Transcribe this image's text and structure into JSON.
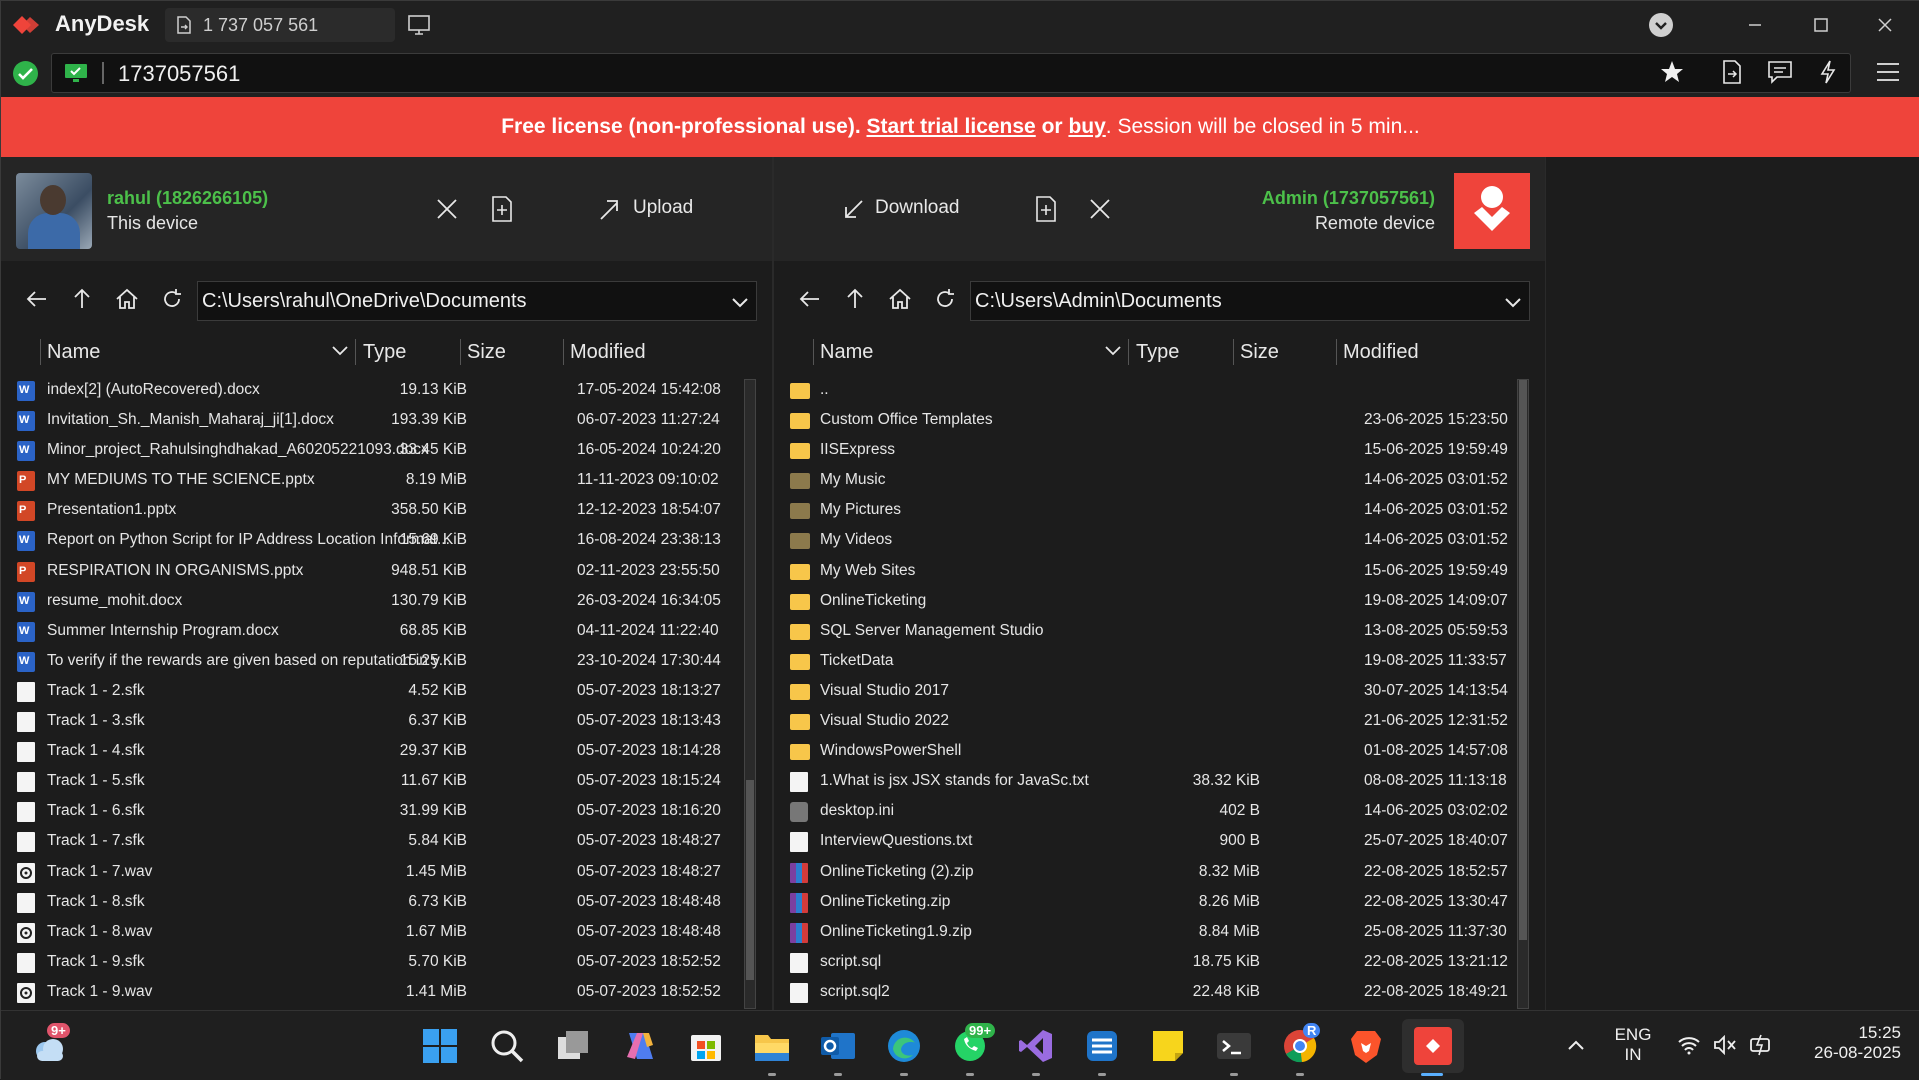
{
  "titlebar": {
    "app_name": "AnyDesk",
    "session_tab": "1 737 057 561"
  },
  "addressbar": {
    "value": "1737057561"
  },
  "banner": {
    "prefix": "Free license (non-professional use).",
    "trial_link": "Start trial license",
    "or": "or",
    "buy_link": "buy",
    "suffix": ". Session will be closed in 5 min..."
  },
  "local": {
    "user": "rahul (1826266105)",
    "subtitle": "This device",
    "upload_label": "Upload",
    "path": "C:\\Users\\rahul\\OneDrive\\Documents",
    "columns": {
      "name": "Name",
      "type": "Type",
      "size": "Size",
      "modified": "Modified"
    },
    "files": [
      {
        "icon": "word-icon",
        "name": "index[2] (AutoRecovered).docx",
        "size": "19.13 KiB",
        "modified": "17-05-2024 15:42:08"
      },
      {
        "icon": "word-icon",
        "name": "Invitation_Sh._Manish_Maharaj_ji[1].docx",
        "size": "193.39 KiB",
        "modified": "06-07-2023 11:27:24"
      },
      {
        "icon": "word-icon",
        "name": "Minor_project_Rahulsinghdhakad_A60205221093.docx",
        "size": "33.45 KiB",
        "modified": "16-05-2024 10:24:20"
      },
      {
        "icon": "ppt-icon",
        "name": "MY MEDIUMS TO THE SCIENCE.pptx",
        "size": "8.19 MiB",
        "modified": "11-11-2023 09:10:02"
      },
      {
        "icon": "ppt-icon",
        "name": "Presentation1.pptx",
        "size": "358.50 KiB",
        "modified": "12-12-2023 18:54:07"
      },
      {
        "icon": "word-icon",
        "name": "Report on Python Script for IP Address Location Informat...",
        "size": "15.69 KiB",
        "modified": "16-08-2024 23:38:13"
      },
      {
        "icon": "ppt-icon",
        "name": "RESPIRATION IN ORGANISMS.pptx",
        "size": "948.51 KiB",
        "modified": "02-11-2023 23:55:50"
      },
      {
        "icon": "word-icon",
        "name": "resume_mohit.docx",
        "size": "130.79 KiB",
        "modified": "26-03-2024 16:34:05"
      },
      {
        "icon": "word-icon",
        "name": "Summer Internship Program.docx",
        "size": "68.85 KiB",
        "modified": "04-11-2024 11:22:40"
      },
      {
        "icon": "word-icon",
        "name": "To verify if the rewards are given based on reputation in y...",
        "size": "15.25 KiB",
        "modified": "23-10-2024 17:30:44"
      },
      {
        "icon": "file-icon",
        "name": "Track 1 - 2.sfk",
        "size": "4.52 KiB",
        "modified": "05-07-2023 18:13:27"
      },
      {
        "icon": "file-icon",
        "name": "Track 1 - 3.sfk",
        "size": "6.37 KiB",
        "modified": "05-07-2023 18:13:43"
      },
      {
        "icon": "file-icon",
        "name": "Track 1 - 4.sfk",
        "size": "29.37 KiB",
        "modified": "05-07-2023 18:14:28"
      },
      {
        "icon": "file-icon",
        "name": "Track 1 - 5.sfk",
        "size": "11.67 KiB",
        "modified": "05-07-2023 18:15:24"
      },
      {
        "icon": "file-icon",
        "name": "Track 1 - 6.sfk",
        "size": "31.99 KiB",
        "modified": "05-07-2023 18:16:20"
      },
      {
        "icon": "file-icon",
        "name": "Track 1 - 7.sfk",
        "size": "5.84 KiB",
        "modified": "05-07-2023 18:48:27"
      },
      {
        "icon": "audio-icon",
        "name": "Track 1 - 7.wav",
        "size": "1.45 MiB",
        "modified": "05-07-2023 18:48:27"
      },
      {
        "icon": "file-icon",
        "name": "Track 1 - 8.sfk",
        "size": "6.73 KiB",
        "modified": "05-07-2023 18:48:48"
      },
      {
        "icon": "audio-icon",
        "name": "Track 1 - 8.wav",
        "size": "1.67 MiB",
        "modified": "05-07-2023 18:48:48"
      },
      {
        "icon": "file-icon",
        "name": "Track 1 - 9.sfk",
        "size": "5.70 KiB",
        "modified": "05-07-2023 18:52:52"
      },
      {
        "icon": "audio-icon",
        "name": "Track 1 - 9.wav",
        "size": "1.41 MiB",
        "modified": "05-07-2023 18:52:52"
      }
    ]
  },
  "remote": {
    "user": "Admin (1737057561)",
    "subtitle": "Remote device",
    "download_label": "Download",
    "path": "C:\\Users\\Admin\\Documents",
    "columns": {
      "name": "Name",
      "type": "Type",
      "size": "Size",
      "modified": "Modified"
    },
    "files": [
      {
        "icon": "folder-icon",
        "name": "..",
        "size": "",
        "modified": ""
      },
      {
        "icon": "folder-icon",
        "name": "Custom Office Templates",
        "size": "",
        "modified": "23-06-2025 15:23:50"
      },
      {
        "icon": "folder-icon",
        "name": "IISExpress",
        "size": "",
        "modified": "15-06-2025 19:59:49"
      },
      {
        "icon": "folder-dark-icon",
        "name": "My Music",
        "size": "",
        "modified": "14-06-2025 03:01:52"
      },
      {
        "icon": "folder-dark-icon",
        "name": "My Pictures",
        "size": "",
        "modified": "14-06-2025 03:01:52"
      },
      {
        "icon": "folder-dark-icon",
        "name": "My Videos",
        "size": "",
        "modified": "14-06-2025 03:01:52"
      },
      {
        "icon": "folder-icon",
        "name": "My Web Sites",
        "size": "",
        "modified": "15-06-2025 19:59:49"
      },
      {
        "icon": "folder-icon",
        "name": "OnlineTicketing",
        "size": "",
        "modified": "19-08-2025 14:09:07"
      },
      {
        "icon": "folder-icon",
        "name": "SQL Server Management Studio",
        "size": "",
        "modified": "13-08-2025 05:59:53"
      },
      {
        "icon": "folder-icon",
        "name": "TicketData",
        "size": "",
        "modified": "19-08-2025 11:33:57"
      },
      {
        "icon": "folder-icon",
        "name": "Visual Studio 2017",
        "size": "",
        "modified": "30-07-2025 14:13:54"
      },
      {
        "icon": "folder-icon",
        "name": "Visual Studio 2022",
        "size": "",
        "modified": "21-06-2025 12:31:52"
      },
      {
        "icon": "folder-icon",
        "name": "WindowsPowerShell",
        "size": "",
        "modified": "01-08-2025 14:57:08"
      },
      {
        "icon": "file-icon",
        "name": "1.What is jsx JSX stands for JavaSc.txt",
        "size": "38.32 KiB",
        "modified": "08-08-2025 11:13:18"
      },
      {
        "icon": "settings-file-icon",
        "name": "desktop.ini",
        "size": "402 B",
        "modified": "14-06-2025 03:02:02"
      },
      {
        "icon": "file-icon",
        "name": "InterviewQuestions.txt",
        "size": "900 B",
        "modified": "25-07-2025 18:40:07"
      },
      {
        "icon": "zip-icon",
        "name": "OnlineTicketing (2).zip",
        "size": "8.32 MiB",
        "modified": "22-08-2025 18:52:57"
      },
      {
        "icon": "zip-icon",
        "name": "OnlineTicketing.zip",
        "size": "8.26 MiB",
        "modified": "22-08-2025 13:30:47"
      },
      {
        "icon": "zip-icon",
        "name": "OnlineTicketing1.9.zip",
        "size": "8.84 MiB",
        "modified": "25-08-2025 11:37:30"
      },
      {
        "icon": "sql-icon",
        "name": "script.sql",
        "size": "18.75 KiB",
        "modified": "22-08-2025 13:21:12"
      },
      {
        "icon": "file-icon",
        "name": "script.sql2",
        "size": "22.48 KiB",
        "modified": "22-08-2025 18:49:21"
      }
    ]
  },
  "taskbar": {
    "weather_badge": "9+",
    "whatsapp_badge": "99+",
    "chrome_badge": "R",
    "lang_top": "ENG",
    "lang_bottom": "IN",
    "time": "15:25",
    "date": "26-08-2025"
  },
  "colors": {
    "accent_red": "#ef443b",
    "online_green": "#4cc04a",
    "titlebar": "#202020",
    "background": "#1c1c1c"
  }
}
